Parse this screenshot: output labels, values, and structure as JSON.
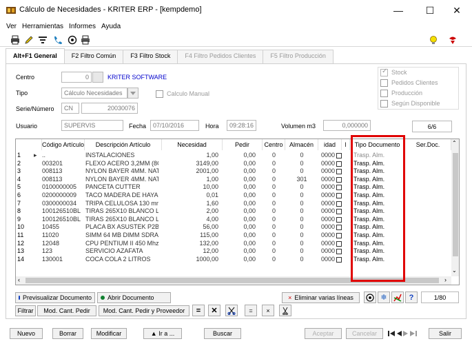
{
  "window": {
    "title": "Cálculo de Necesidades - KRITER ERP - [kempdemo]"
  },
  "menu": [
    "Ver",
    "Herramientas",
    "Informes",
    "Ayuda"
  ],
  "tabs": [
    {
      "label": "Alt+F1 General"
    },
    {
      "label": "F2 Filtro Común"
    },
    {
      "label": "F3 Filtro Stock"
    },
    {
      "label": "F4 Filtro Pedidos Clientes"
    },
    {
      "label": "F5 Filtro Producción"
    }
  ],
  "form": {
    "centro_label": "Centro",
    "centro_value": "0",
    "centro_name": "KRITER SOFTWARE",
    "tipo_label": "Tipo",
    "tipo_value": "Cálculo Necesidades",
    "calculo_manual_label": "Calculo Manual",
    "serie_label": "Serie/Número",
    "serie_value": "CN",
    "numero_value": "20030076",
    "usuario_label": "Usuario",
    "usuario_value": "SUPERVIS",
    "fecha_label": "Fecha",
    "fecha_value": "07/10/2016",
    "hora_label": "Hora",
    "hora_value": "09:28:16",
    "volumen_label": "Volumen m3",
    "volumen_value": "0,000000",
    "page_counter": "6/6",
    "checks": [
      {
        "label": "Stock",
        "checked": true
      },
      {
        "label": "Pedidos Clientes",
        "checked": false
      },
      {
        "label": "Producción",
        "checked": false
      },
      {
        "label": "Según Disponible",
        "checked": false
      }
    ]
  },
  "grid": {
    "headers": [
      "Código Artículo",
      "Descripción Artículo",
      "Necesidad",
      "Pedir",
      "Centro",
      "Almacén",
      "idad",
      "l",
      "Tipo Documento",
      "Ser.Doc."
    ],
    "rows": [
      {
        "n": "1",
        "code": "..",
        "desc": "INSTALACIONES",
        "nec": "1,00",
        "ped": "0,00",
        "cen": "0",
        "alm": "0",
        "uni": "0000",
        "tipo": "Trasp. Alm."
      },
      {
        "n": "2",
        "code": "003201",
        "desc": "FLEXO ACERO 3,2MM (8CI",
        "nec": "3149,00",
        "ped": "0,00",
        "cen": "0",
        "alm": "0",
        "uni": "0000",
        "tipo": "Trasp. Alm."
      },
      {
        "n": "3",
        "code": "008113",
        "desc": "NYLON BAYER 4MM. NAT",
        "nec": "2001,00",
        "ped": "0,00",
        "cen": "0",
        "alm": "0",
        "uni": "0000",
        "tipo": "Trasp. Alm."
      },
      {
        "n": "4",
        "code": "008113",
        "desc": "NYLON BAYER 4MM. NAT",
        "nec": "1,00",
        "ped": "0,00",
        "cen": "0",
        "alm": "301",
        "uni": "0000",
        "tipo": "Trasp. Alm."
      },
      {
        "n": "5",
        "code": "0100000005",
        "desc": "PANCETA CUTTER",
        "nec": "10,00",
        "ped": "0,00",
        "cen": "0",
        "alm": "0",
        "uni": "0000",
        "tipo": "Trasp. Alm."
      },
      {
        "n": "6",
        "code": "0200000009",
        "desc": "TACO MADERA DE HAYA",
        "nec": "0,01",
        "ped": "0,00",
        "cen": "0",
        "alm": "0",
        "uni": "0000",
        "tipo": "Trasp. Alm."
      },
      {
        "n": "7",
        "code": "0300000034",
        "desc": "TRIPA CELULOSA 130 mm",
        "nec": "1,60",
        "ped": "0,00",
        "cen": "0",
        "alm": "0",
        "uni": "0000",
        "tipo": "Trasp. Alm."
      },
      {
        "n": "8",
        "code": "100126510BL",
        "desc": "TIRAS 265X10 BLANCO LI",
        "nec": "2,00",
        "ped": "0,00",
        "cen": "0",
        "alm": "0",
        "uni": "0000",
        "tipo": "Trasp. Alm."
      },
      {
        "n": "9",
        "code": "100126510BL",
        "desc": "TIRAS 265X10 BLANCO LI",
        "nec": "4,00",
        "ped": "0,00",
        "cen": "0",
        "alm": "0",
        "uni": "0000",
        "tipo": "Trasp. Alm."
      },
      {
        "n": "10",
        "code": "10455",
        "desc": "PLACA BX ASUSTEK P2B",
        "nec": "56,00",
        "ped": "0,00",
        "cen": "0",
        "alm": "0",
        "uni": "0000",
        "tipo": "Trasp. Alm."
      },
      {
        "n": "11",
        "code": "11020",
        "desc": "SIMM 64 MB DIMM SDRAI",
        "nec": "115,00",
        "ped": "0,00",
        "cen": "0",
        "alm": "0",
        "uni": "0000",
        "tipo": "Trasp. Alm."
      },
      {
        "n": "12",
        "code": "12048",
        "desc": "CPU PENTIUM II 450 Mhz",
        "nec": "132,00",
        "ped": "0,00",
        "cen": "0",
        "alm": "0",
        "uni": "0000",
        "tipo": "Trasp. Alm."
      },
      {
        "n": "13",
        "code": "123",
        "desc": "SERVICIO AZAFATA",
        "nec": "12,00",
        "ped": "0,00",
        "cen": "0",
        "alm": "0",
        "uni": "0000",
        "tipo": "Trasp. Alm."
      },
      {
        "n": "14",
        "code": "130001",
        "desc": "COCA COLA 2 LITROS",
        "nec": "1000,00",
        "ped": "0,00",
        "cen": "0",
        "alm": "0",
        "uni": "0000",
        "tipo": "Trasp. Alm."
      }
    ]
  },
  "actions": {
    "previsualizar": "Previsualizar Documento",
    "abrir": "Abrir Documento",
    "eliminar": "Eliminar varias líneas",
    "record_counter": "1/80",
    "filtrar": "Filtrar",
    "mod_cant_pedir": "Mod. Cant. Pedir",
    "mod_cant_pedir_proveedor": "Mod. Cant. Pedir y Proveedor"
  },
  "footer": {
    "nuevo": "Nuevo",
    "borrar": "Borrar",
    "modificar": "Modificar",
    "ira": "▲ Ir a ...",
    "buscar": "Buscar",
    "aceptar": "Aceptar",
    "cancelar": "Cancelar",
    "salir": "Salir"
  },
  "colors": {
    "accent_link": "#0000cc",
    "highlight": "#e00000"
  }
}
